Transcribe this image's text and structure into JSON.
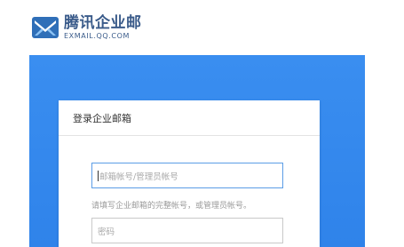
{
  "brand": {
    "name_cn": "腾讯企业邮",
    "name_en": "EXMAIL.QQ.COM",
    "logo_icon": "exmail-envelope-logo",
    "color": "#3a5b8a"
  },
  "banner": {
    "color": "#3a8ef0"
  },
  "login": {
    "title": "登录企业邮箱",
    "account_placeholder": "邮箱帐号/管理员帐号",
    "hint": "请填写企业邮箱的完整帐号，或管理员帐号。",
    "password_placeholder": "密码"
  }
}
